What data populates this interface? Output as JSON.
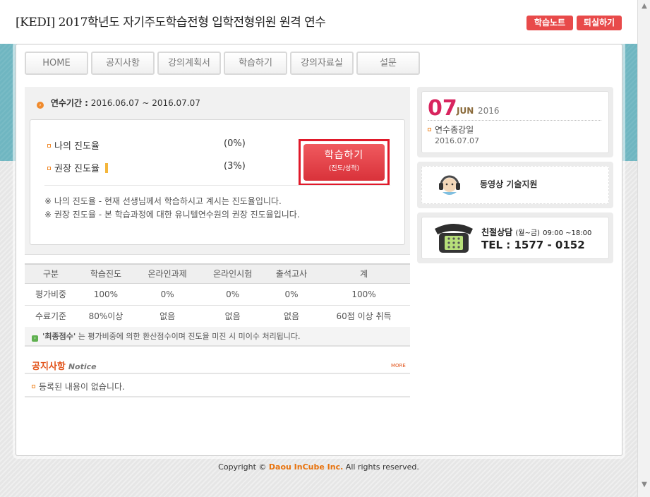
{
  "header": {
    "title": "[KEDI] 2017학년도 자기주도학습전형 입학전형위원 원격 연수",
    "note_button": "학습노트",
    "logout_button": "퇴실하기"
  },
  "tabs": [
    {
      "label": "HOME"
    },
    {
      "label": "공지사항"
    },
    {
      "label": "강의계획서"
    },
    {
      "label": "학습하기"
    },
    {
      "label": "강의자료실"
    },
    {
      "label": "설문"
    }
  ],
  "period": {
    "label": "연수기간 :",
    "value": "2016.06.07 ~ 2016.07.07"
  },
  "progress": {
    "my_label": "나의 진도율",
    "my_value": "(0%)",
    "recommended_label": "권장 진도율",
    "recommended_value": "(3%)",
    "recommended_fraction": 0.03,
    "study_button": "학습하기",
    "study_button_sub": "(진도/성적)",
    "note1": "※ 나의 진도율 - 현재 선생님께서 학습하시고 계시는 진도율입니다.",
    "note2": "※ 권장 진도율 - 본 학습과정에 대한 유니텔연수원의 권장 진도율입니다."
  },
  "grade_table": {
    "headers": [
      "구분",
      "학습진도",
      "온라인과제",
      "온라인시험",
      "출석고사",
      "계"
    ],
    "rows": [
      [
        "평가비중",
        "100%",
        "0%",
        "0%",
        "0%",
        "100%"
      ],
      [
        "수료기준",
        "80%이상",
        "없음",
        "없음",
        "없음",
        "60점 이상 취득"
      ]
    ]
  },
  "score_note": {
    "bold": "'최종점수'",
    "text": " 는 평가비중에 의한 환산점수이며 진도율 미진 시 미이수 처리됩니다."
  },
  "notice": {
    "title_ko": "공지사항",
    "title_en": "Notice",
    "more": "MORE",
    "empty": "등록된 내용이 없습니다."
  },
  "date_card": {
    "day": "07",
    "month": "JUN",
    "year": "2016",
    "label": "연수종강일",
    "value": "2016.07.07"
  },
  "support": {
    "label": "동영상 기술지원"
  },
  "phone": {
    "line1": "친절상담",
    "hours_paren": "(월~금)",
    "hours": "09:00 ~18:00",
    "tel": "TEL : 1577 - 0152"
  },
  "footer": {
    "prefix": "Copyright ©",
    "brand": "Daou InCube Inc.",
    "suffix": "All rights reserved."
  },
  "colors": {
    "accent_red": "#e84a4a",
    "teal": "#6fb6c1",
    "date_pink": "#d8245e",
    "notice_orange": "#e2541b"
  }
}
